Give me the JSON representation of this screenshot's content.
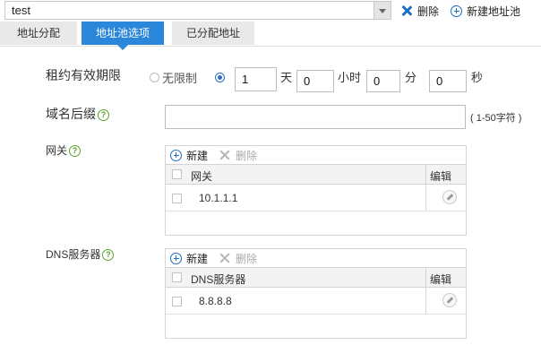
{
  "pool_select": {
    "value": "test"
  },
  "top_actions": {
    "delete": "删除",
    "new_pool": "新建地址池"
  },
  "tabs": [
    {
      "label": "地址分配"
    },
    {
      "label": "地址池选项"
    },
    {
      "label": "已分配地址"
    }
  ],
  "lease": {
    "label": "租约有效期限",
    "unlimited": "无限制",
    "days_value": "1",
    "days_unit": "天",
    "hours_value": "0",
    "hours_unit": "小时",
    "minutes_value": "0",
    "minutes_unit": "分",
    "seconds_value": "0",
    "seconds_unit": "秒"
  },
  "domain_suffix": {
    "label": "域名后缀",
    "value": "",
    "hint": "( 1-50字符 )"
  },
  "gateway": {
    "label": "网关",
    "toolbar": {
      "new": "新建",
      "delete": "删除"
    },
    "columns": {
      "name": "网关",
      "edit": "编辑"
    },
    "rows": [
      {
        "value": "10.1.1.1"
      }
    ]
  },
  "dns": {
    "label": "DNS服务器",
    "toolbar": {
      "new": "新建",
      "delete": "删除"
    },
    "columns": {
      "name": "DNS服务器",
      "edit": "编辑"
    },
    "rows": [
      {
        "value": "8.8.8.8"
      }
    ]
  },
  "colors": {
    "accent": "#2b87da",
    "help": "#5aa32a"
  }
}
